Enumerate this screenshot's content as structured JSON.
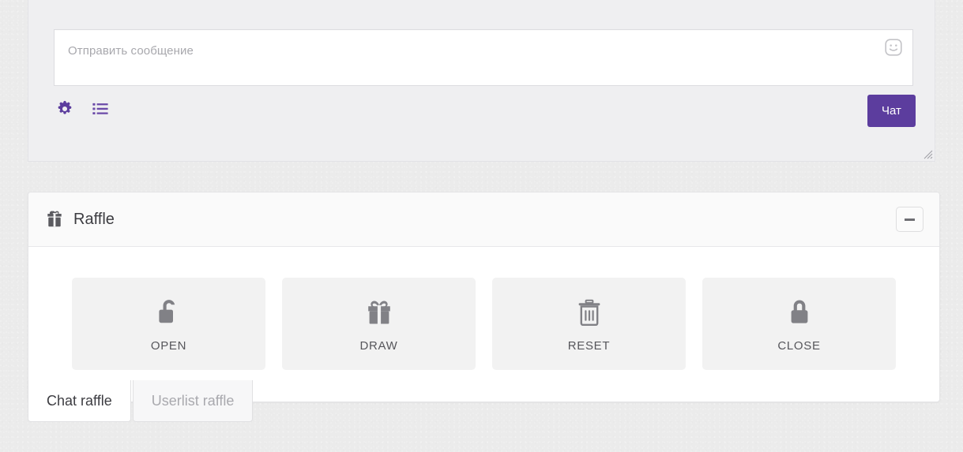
{
  "theme": {
    "accent_purple": "#5c3d9e",
    "page_bg": "#ebebeb",
    "panel_bg": "#efeff1",
    "card_bg": "#ffffff",
    "button_bg": "#f2f2f2",
    "icon_gray": "#7f7f83"
  },
  "chat": {
    "placeholder": "Отправить сообщение",
    "input_value": "",
    "send_label": "Чат",
    "emoji_icon": "smiley-face-icon",
    "toolbar": [
      {
        "icon": "gear-icon",
        "name": "chat-settings-button"
      },
      {
        "icon": "list-icon",
        "name": "chat-userlist-button"
      }
    ],
    "resize_grip": "resize-grip-icon"
  },
  "raffle": {
    "title": "Raffle",
    "header_icon": "gift-icon",
    "minimize_label": "—",
    "actions": [
      {
        "label": "OPEN",
        "icon": "unlock-icon"
      },
      {
        "label": "DRAW",
        "icon": "gift-icon"
      },
      {
        "label": "RESET",
        "icon": "trash-icon"
      },
      {
        "label": "CLOSE",
        "icon": "lock-icon"
      }
    ],
    "tabs": [
      {
        "label": "Chat raffle",
        "active": true
      },
      {
        "label": "Userlist raffle",
        "active": false
      }
    ]
  }
}
